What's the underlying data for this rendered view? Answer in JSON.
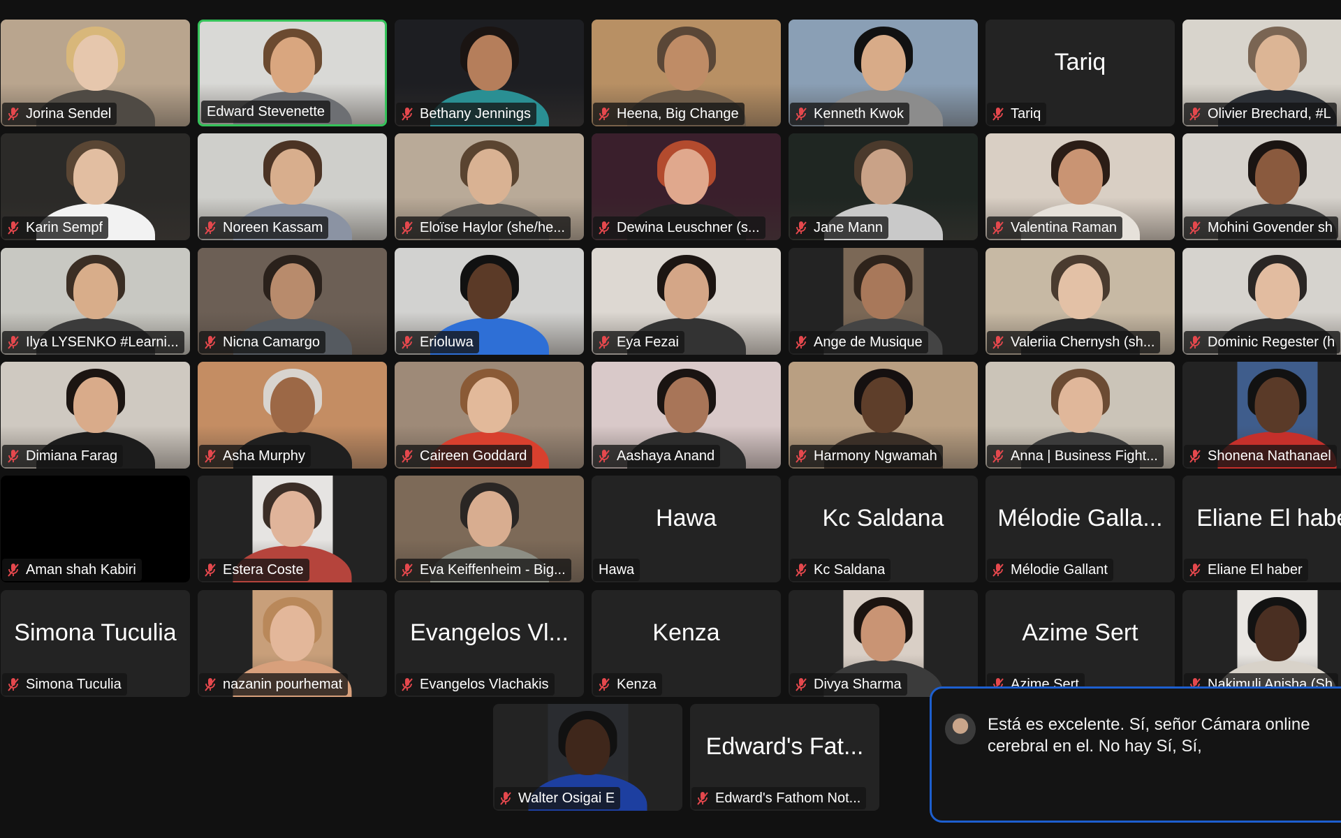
{
  "participants": [
    {
      "name": "Jorina Sendel",
      "muted": true,
      "video": "on",
      "bg": "#b9a58e",
      "skin": "#e6c7ad",
      "hair": "#d8b77a",
      "shirt": "#4f4a44"
    },
    {
      "name": "Edward Stevenette",
      "muted": false,
      "speaking": true,
      "video": "on",
      "bg": "#d9d9d6",
      "skin": "#d9a67f",
      "hair": "#6b4a30",
      "shirt": "#6d6f73"
    },
    {
      "name": "Bethany Jennings",
      "muted": true,
      "video": "on",
      "bg": "#1d1e22",
      "skin": "#b57e5b",
      "hair": "#1a1412",
      "shirt": "#2a8f93"
    },
    {
      "name": "Heena, Big Change",
      "muted": true,
      "video": "on",
      "bg": "#b89064",
      "skin": "#bf8c66",
      "hair": "#5a4737",
      "shirt": "#6b5a48"
    },
    {
      "name": "Kenneth Kwok",
      "muted": true,
      "video": "on",
      "bg": "#8a9fb5",
      "skin": "#d8ab88",
      "hair": "#111111",
      "shirt": "#8c8c8c"
    },
    {
      "name": "Tariq",
      "muted": true,
      "video": "off"
    },
    {
      "name": "Olivier Brechard, #LearningPlanet",
      "muted": true,
      "video": "on",
      "bg": "#d8d4cc",
      "skin": "#dcb595",
      "hair": "#7a6553",
      "shirt": "#2c3036"
    },
    {
      "name": "Karin Sempf",
      "muted": true,
      "video": "on",
      "bg": "#2b2a28",
      "skin": "#e2bea1",
      "hair": "#5a4634",
      "shirt": "#f2f2f2"
    },
    {
      "name": "Noreen Kassam",
      "muted": true,
      "video": "on",
      "bg": "#cfcfcb",
      "skin": "#d8ae8d",
      "hair": "#4b3324",
      "shirt": "#8b93a3"
    },
    {
      "name": "Eloïse Haylor (she/her), The Student Hub",
      "muted": true,
      "video": "on",
      "bg": "#b9aa98",
      "skin": "#d9b293",
      "hair": "#5a4430",
      "shirt": "#5d5a56"
    },
    {
      "name": "Dewina Leuschner (she/her)",
      "muted": true,
      "video": "on",
      "bg": "#3a1f2c",
      "skin": "#e0a88d",
      "hair": "#b34b2e",
      "shirt": "#222222"
    },
    {
      "name": "Jane Mann",
      "muted": true,
      "video": "on",
      "bg": "#1f2622",
      "skin": "#c9a287",
      "hair": "#4b3a2c",
      "shirt": "#c9c9c9"
    },
    {
      "name": "Valentina Raman",
      "muted": true,
      "video": "on",
      "bg": "#d9cfc4",
      "skin": "#c99473",
      "hair": "#2b1d16",
      "shirt": "#e6e1da"
    },
    {
      "name": "Mohini Govender she/her",
      "muted": true,
      "video": "on",
      "bg": "#d6d2cc",
      "skin": "#8a5a3e",
      "hair": "#1a1412",
      "shirt": "#3c3c3c"
    },
    {
      "name": "Ilya LYSENKO #LearningPlanet",
      "muted": true,
      "video": "on",
      "bg": "#c8c8c2",
      "skin": "#d8ad8a",
      "hair": "#3b2e24",
      "shirt": "#3b3b3b"
    },
    {
      "name": "Nicna Camargo",
      "muted": true,
      "video": "on",
      "bg": "#6c5f55",
      "skin": "#b88b6c",
      "hair": "#2a211b",
      "shirt": "#555a60"
    },
    {
      "name": "Erioluwa",
      "muted": true,
      "video": "on",
      "bg": "#d2d2d0",
      "skin": "#5b3a27",
      "hair": "#111111",
      "shirt": "#2e6fd6"
    },
    {
      "name": "Eya Fezai",
      "muted": true,
      "video": "on",
      "bg": "#ddd8d2",
      "skin": "#d4a687",
      "hair": "#1c1512",
      "shirt": "#333333"
    },
    {
      "name": "Ange de Musique",
      "muted": true,
      "video": "portrait",
      "bg": "#7b6856",
      "skin": "#a8785a",
      "hair": "#2e231b",
      "shirt": "#444444"
    },
    {
      "name": "Valeriia Chernysh (she/her)",
      "muted": true,
      "video": "on",
      "bg": "#c7b9a4",
      "skin": "#e3c1a6",
      "hair": "#4a3b2f",
      "shirt": "#2b2b2b"
    },
    {
      "name": "Dominic Regester (he/him)",
      "muted": true,
      "video": "on",
      "bg": "#d6d3ce",
      "skin": "#e2bca0",
      "hair": "#2a2624",
      "shirt": "#2f2f2f"
    },
    {
      "name": "Dimiana Farag",
      "muted": true,
      "video": "on",
      "bg": "#cfc9c1",
      "skin": "#d9ab8a",
      "hair": "#1c1512",
      "shirt": "#1c1c1c"
    },
    {
      "name": "Asha Murphy",
      "muted": true,
      "video": "on",
      "bg": "#c48d63",
      "skin": "#9c6846",
      "hair": "#d8d4cf",
      "shirt": "#1f1f1f"
    },
    {
      "name": "Caireen Goddard",
      "muted": true,
      "video": "on",
      "bg": "#9e8a78",
      "skin": "#e2b99a",
      "hair": "#8a5a36",
      "shirt": "#d8402e"
    },
    {
      "name": "Aashaya Anand",
      "muted": true,
      "video": "on",
      "bg": "#d9c9c9",
      "skin": "#a87558",
      "hair": "#1a1412",
      "shirt": "#2c2c2c"
    },
    {
      "name": "Harmony Ngwamah",
      "muted": true,
      "video": "on",
      "bg": "#b99f82",
      "skin": "#5e3e2a",
      "hair": "#151010",
      "shirt": "#3a2f27"
    },
    {
      "name": "Anna | Business Fights Poverty",
      "muted": true,
      "video": "on",
      "bg": "#cbc4b8",
      "skin": "#e0b79a",
      "hair": "#6b4b33",
      "shirt": "#3b3b3b"
    },
    {
      "name": "Shonena Nathanael",
      "muted": true,
      "video": "portrait",
      "bg": "#3f5d8c",
      "skin": "#5a3a28",
      "hair": "#121212",
      "shirt": "#c4302b"
    },
    {
      "name": "Aman shah Kabiri",
      "muted": true,
      "video": "black"
    },
    {
      "name": "Estera Coste",
      "muted": true,
      "video": "portrait",
      "bg": "#e6e4e2",
      "skin": "#e0b49a",
      "hair": "#3a2d26",
      "shirt": "#b5443c"
    },
    {
      "name": "Eva Keiffenheim - Big Change",
      "muted": true,
      "video": "on",
      "bg": "#7d6a58",
      "skin": "#d8ad90",
      "hair": "#2a2624",
      "shirt": "#8d8e84"
    },
    {
      "name": "Hawa",
      "muted": false,
      "video": "off"
    },
    {
      "name": "Kc Saldana",
      "muted": true,
      "video": "off"
    },
    {
      "name": "Mélodie Gallant",
      "muted": true,
      "video": "off"
    },
    {
      "name": "Eliane El haber",
      "muted": true,
      "video": "off"
    },
    {
      "name": "Simona Tuculia",
      "muted": true,
      "video": "off"
    },
    {
      "name": "nazanin pourhemat",
      "muted": true,
      "video": "portrait",
      "bg": "#c89f7a",
      "skin": "#e3b79a",
      "hair": "#b9885a",
      "shirt": "#d8a07c"
    },
    {
      "name": "Evangelos Vlachakis",
      "muted": true,
      "video": "off"
    },
    {
      "name": "Kenza",
      "muted": true,
      "video": "off"
    },
    {
      "name": "Divya Sharma",
      "muted": true,
      "video": "portrait",
      "bg": "#d9cfc6",
      "skin": "#c99474",
      "hair": "#1c1410",
      "shirt": "#3b3b3b"
    },
    {
      "name": "Azime Sert",
      "muted": true,
      "video": "off"
    },
    {
      "name": "Nakimuli Anisha (She/her)",
      "muted": true,
      "video": "portrait",
      "bg": "#e9e6e2",
      "skin": "#4a2f22",
      "hair": "#121212",
      "shirt": "#d8d2c9"
    },
    {
      "name": "Walter Osigai E",
      "muted": true,
      "video": "portrait",
      "bg": "#2a2c30",
      "skin": "#3f271b",
      "hair": "#111111",
      "shirt": "#1d3fa0"
    },
    {
      "name": "Edward's Fathom Notetaker",
      "muted": true,
      "video": "off"
    }
  ],
  "avatar_labels": {
    "Tariq": "Tariq",
    "Hawa": "Hawa",
    "Kc Saldana": "Kc Saldana",
    "Mélodie Gallant": "Mélodie Galla...",
    "Eliane El haber": "Eliane El haber",
    "Simona Tuculia": "Simona Tuculia",
    "Evangelos Vlachakis": "Evangelos Vl...",
    "Kenza": "Kenza",
    "Azime Sert": "Azime Sert",
    "Edward's Fathom Notetaker": "Edward's Fat..."
  },
  "nameplates": {
    "Eloïse Haylor (she/her), The Student Hub": "Eloïse Haylor (she/he...",
    "Dewina Leuschner (she/her)": "Dewina Leuschner (s...",
    "Ilya LYSENKO #LearningPlanet": "Ilya LYSENKO #Learni...",
    "Valeriia Chernysh (she/her)": "Valeriia Chernysh (sh...",
    "Anna | Business Fights Poverty": "Anna | Business Fight...",
    "Eva Keiffenheim - Big Change": "Eva Keiffenheim - Big...",
    "Edward's Fathom Notetaker": "Edward's Fathom Not...",
    "Olivier Brechard, #LearningPlanet": "Olivier Brechard, #L",
    "Mohini Govender she/her": "Mohini Govender sh",
    "Dominic Regester (he/him)": "Dominic Regester (h",
    "Nakimuli Anisha (She/her)": "Nakimuli Anisha (Sh",
    "Eliane El haber": "Eliane El haber"
  },
  "caption": {
    "text": "Está es excelente. Sí, señor Cámara online cerebral en el. No hay Sí, Sí,"
  },
  "colors": {
    "background": "#111111",
    "tile": "#232323",
    "speaking_border": "#35c35a",
    "muted_icon": "#e5484d",
    "caption_border": "#1d5fcf"
  }
}
